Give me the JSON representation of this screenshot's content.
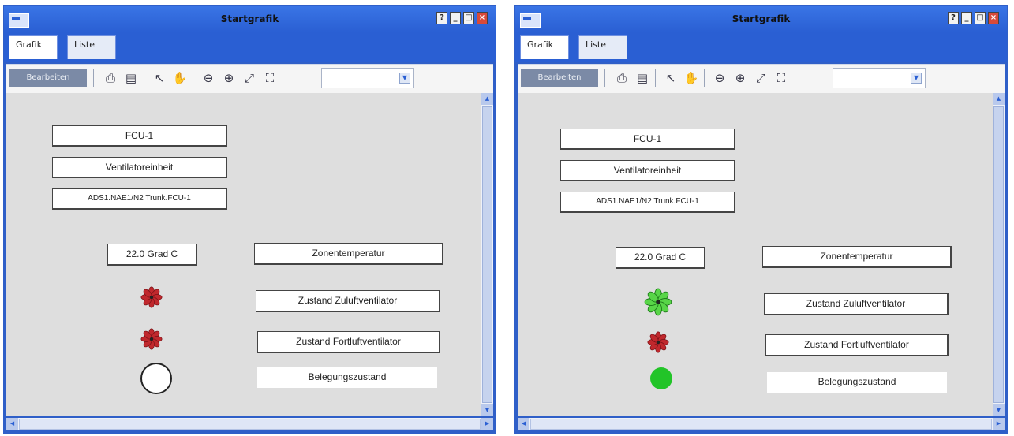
{
  "window_title": "Startgrafik",
  "tabs": [
    "Grafik",
    "Liste"
  ],
  "toolbar": {
    "edit_button": "Bearbeiten",
    "icons": [
      "print-icon",
      "print-preview-icon",
      "pointer-icon",
      "pan-hand-icon",
      "zoom-out-icon",
      "zoom-in-icon",
      "zoom-fit-icon",
      "zoom-select-icon"
    ]
  },
  "panels": [
    {
      "device_name": "FCU-1",
      "device_type": "Ventilatoreinheit",
      "device_reference": "ADS1.NAE1/N2 Trunk.FCU-1",
      "temperature_value": "22.0 Grad C",
      "zone_temp_label": "Zonentemperatur",
      "supply_fan_label": "Zustand Zuluftventilator",
      "exhaust_fan_label": "Zustand Fortluftventilator",
      "occupancy_label": "Belegungszustand",
      "supply_fan_state": "off",
      "exhaust_fan_state": "off",
      "occupancy_state": "unoccupied"
    },
    {
      "device_name": "FCU-1",
      "device_type": "Ventilatoreinheit",
      "device_reference": "ADS1.NAE1/N2 Trunk.FCU-1",
      "temperature_value": "22.0 Grad C",
      "zone_temp_label": "Zonentemperatur",
      "supply_fan_label": "Zustand Zuluftventilator",
      "exhaust_fan_label": "Zustand Fortluftventilator",
      "occupancy_label": "Belegungszustand",
      "supply_fan_state": "on",
      "exhaust_fan_state": "off",
      "occupancy_state": "occupied"
    }
  ],
  "colors": {
    "fan_off": "#c0282d",
    "fan_on": "#58d548",
    "occupied": "#22c428",
    "unoccupied": "#ffffff",
    "title_bar": "#2f63d6"
  }
}
